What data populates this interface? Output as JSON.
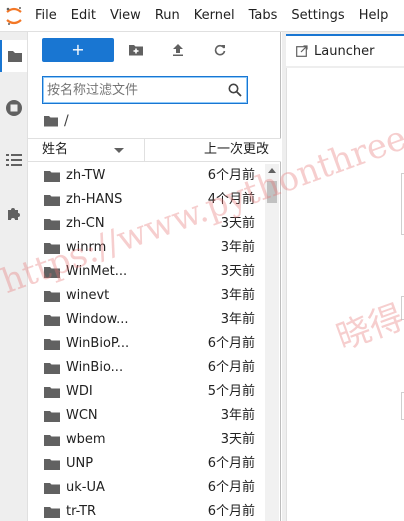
{
  "menubar": {
    "items": [
      "File",
      "Edit",
      "View",
      "Run",
      "Kernel",
      "Tabs",
      "Settings",
      "Help"
    ]
  },
  "toolbar": {
    "new_label": "+"
  },
  "search": {
    "placeholder": "按名称过滤文件",
    "value": ""
  },
  "breadcrumb": {
    "path": "/"
  },
  "list_header": {
    "name": "姓名",
    "modified": "上一次更改"
  },
  "files": [
    {
      "name": "zh-TW",
      "modified": "6个月前"
    },
    {
      "name": "zh-HANS",
      "modified": "4个月前"
    },
    {
      "name": "zh-CN",
      "modified": "3天前"
    },
    {
      "name": "winrm",
      "modified": "3年前"
    },
    {
      "name": "WinMet...",
      "modified": "3天前"
    },
    {
      "name": "winevt",
      "modified": "3年前"
    },
    {
      "name": "Window...",
      "modified": "3年前"
    },
    {
      "name": "WinBioP...",
      "modified": "6个月前"
    },
    {
      "name": "WinBio...",
      "modified": "6个月前"
    },
    {
      "name": "WDI",
      "modified": "5个月前"
    },
    {
      "name": "WCN",
      "modified": "3年前"
    },
    {
      "name": "wbem",
      "modified": "3天前"
    },
    {
      "name": "UNP",
      "modified": "6个月前"
    },
    {
      "name": "uk-UA",
      "modified": "6个月前"
    },
    {
      "name": "tr-TR",
      "modified": "6个月前"
    }
  ],
  "main": {
    "tab_label": "Launcher"
  },
  "watermark": {
    "line1": "https://www.pythonthree",
    "line2": "晓得"
  },
  "colors": {
    "accent": "#1976d2",
    "logo": "#f37726"
  }
}
